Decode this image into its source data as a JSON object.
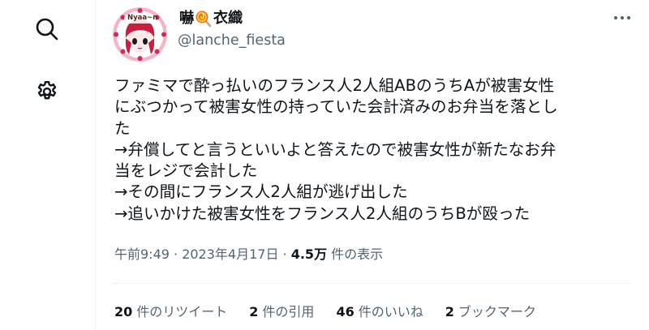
{
  "nav": {
    "search_icon": "search-icon",
    "settings_icon": "gear-icon"
  },
  "tweet": {
    "display_name_before": "嚇",
    "display_name_emoji": "lollipop-icon",
    "display_name_after": "衣織",
    "handle": "@lanche_fiesta",
    "avatar_text": "Nyaa~n",
    "body_lines": [
      "ファミマで酔っ払いのフランス人2人組ABのうちAが被害女性",
      "にぶつかって被害女性の持っていた会計済みのお弁当を落とし",
      "た",
      "→弁償してと言うといいよと答えたので被害女性が新たなお弁",
      "当をレジで会計した",
      "→その間にフランス人2人組が逃げ出した",
      "→追いかけた被害女性をフランス人2人組のうちBが殴った"
    ],
    "timestamp": "午前9:49 · 2023年4月17日 ·",
    "views_count": "4.5万",
    "views_label": "件の表示"
  },
  "stats": {
    "retweets_count": "20",
    "retweets_label": "件のリツイート",
    "quotes_count": "2",
    "quotes_label": "件の引用",
    "likes_count": "46",
    "likes_label": "件のいいね",
    "bookmarks_count": "2",
    "bookmarks_label": "ブックマーク"
  },
  "colors": {
    "text": "#0f1419",
    "secondary": "#536471",
    "avatar_accent": "#d8285a"
  }
}
